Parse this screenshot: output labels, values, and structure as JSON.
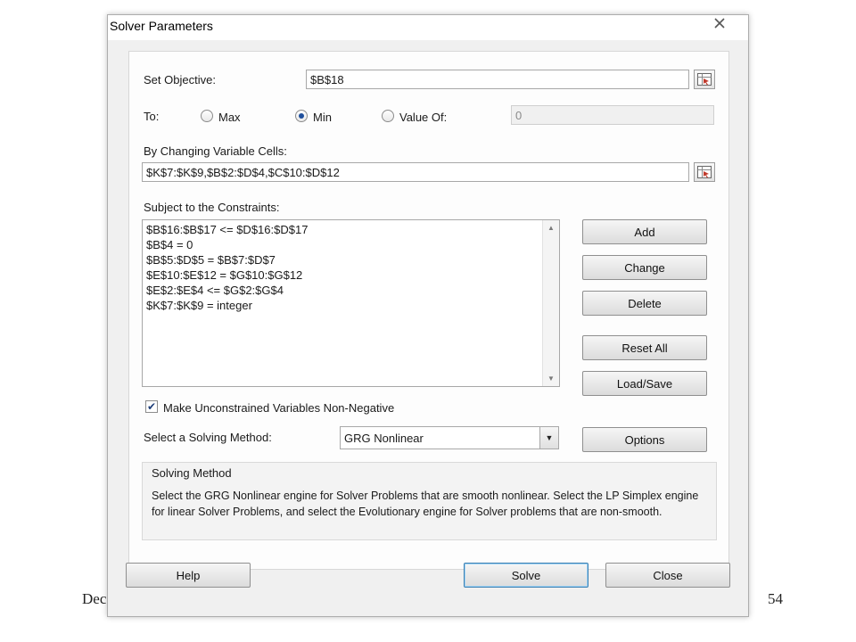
{
  "footer": {
    "left_text": "Dec",
    "page_number": "54"
  },
  "dialog": {
    "title": "Solver Parameters",
    "close_icon": "close-icon"
  },
  "objective": {
    "label": "Set Objective:",
    "value": "$B$18"
  },
  "to": {
    "label": "To:",
    "options": [
      {
        "label": "Max",
        "selected": false
      },
      {
        "label": "Min",
        "selected": true
      },
      {
        "label": "Value Of:",
        "selected": false
      }
    ],
    "value_of": "0"
  },
  "changing_cells": {
    "label": "By Changing Variable Cells:",
    "value": "$K$7:$K$9,$B$2:$D$4,$C$10:$D$12"
  },
  "constraints": {
    "label": "Subject to the Constraints:",
    "items": [
      "$B$16:$B$17 <= $D$16:$D$17",
      "$B$4 = 0",
      "$B$5:$D$5 = $B$7:$D$7",
      "$E$10:$E$12 = $G$10:$G$12",
      "$E$2:$E$4 <= $G$2:$G$4",
      "$K$7:$K$9 = integer"
    ]
  },
  "side_buttons": {
    "add": "Add",
    "change": "Change",
    "delete": "Delete",
    "reset_all": "Reset All",
    "load_save": "Load/Save",
    "options": "Options"
  },
  "non_negative": {
    "label": "Make Unconstrained Variables Non-Negative",
    "checked": true
  },
  "method": {
    "label": "Select a Solving Method:",
    "selected": "GRG Nonlinear"
  },
  "solving_method": {
    "title": "Solving Method",
    "description": "Select the GRG Nonlinear engine for Solver Problems that are smooth nonlinear. Select the LP Simplex engine for linear Solver Problems, and select the Evolutionary engine for Solver problems that are non-smooth."
  },
  "bottom_buttons": {
    "help": "Help",
    "solve": "Solve",
    "close": "Close"
  },
  "colors": {
    "dialog_bg": "#f0f0f0",
    "radio_dot": "#1f4f9c",
    "default_button_border": "#3c7fb1"
  }
}
